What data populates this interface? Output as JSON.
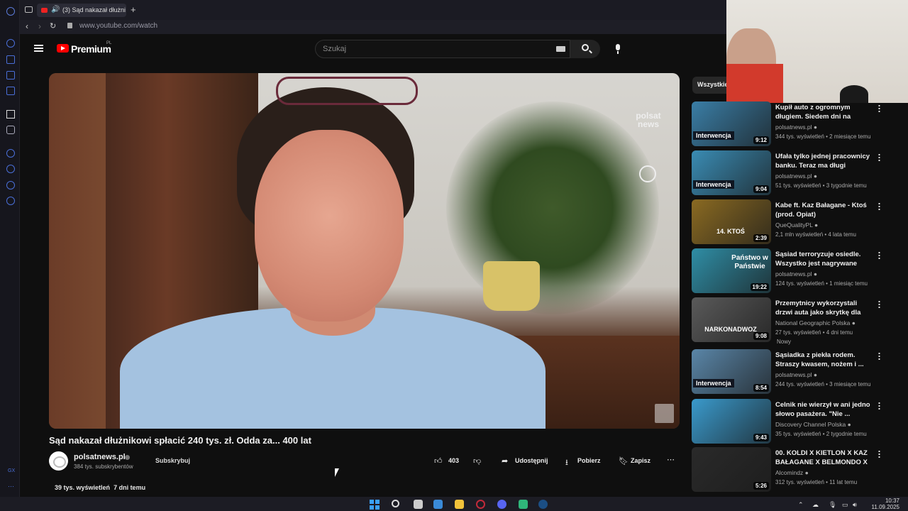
{
  "browser": {
    "tab_title": "(3) Sąd nakazał dłużni",
    "url": "www.youtube.com/watch"
  },
  "youtube": {
    "logo": "Premium",
    "logo_region": "PL",
    "search_placeholder": "Szukaj",
    "filter_chip": "Wszystkie"
  },
  "video": {
    "watermark_line1": "polsat",
    "watermark_line2": "news",
    "title": "Sąd nakazał dłużnikowi spłacić 240 tys. zł. Odda za... 400 lat",
    "channel": "polsatnews.pl",
    "subscribers": "384 tys. subskrybentów",
    "subscribe_label": "Subskrybuj",
    "likes": "403",
    "share_label": "Udostępnij",
    "download_label": "Pobierz",
    "save_label": "Zapisz",
    "views": "39 tys. wyświetleń",
    "age": "7 dni temu"
  },
  "recommendations": [
    {
      "title": "Kupił auto z ogromnym długiem. Siedem dni na zapłatę",
      "channel": "polsatnews.pl",
      "stats": "344 tys. wyświetleń • 2 miesiące temu",
      "duration": "9:12",
      "badge": "Interwencja",
      "thumb_color": "#3a7ea6"
    },
    {
      "title": "Ufała tylko jednej pracownicy banku. Teraz ma długi",
      "channel": "polsatnews.pl",
      "stats": "51 tys. wyświetleń • 3 tygodnie temu",
      "duration": "9:04",
      "badge": "Interwencja",
      "thumb_color": "#3a8cb4"
    },
    {
      "title": "Kabe ft. Kaz Bałagane - Ktoś (prod. Opiat)",
      "channel": "QueQualityPL",
      "stats": "2,1 mln wyświetleń • 4 lata temu",
      "duration": "2:39",
      "thumb_text": "14. KTOŚ",
      "thumb_color": "#8a6a22"
    },
    {
      "title": "Sąsiad terroryzuje osiedle. Wszystko jest nagrywane",
      "channel": "polsatnews.pl",
      "stats": "124 tys. wyświetleń • 1 miesiąc temu",
      "duration": "19:22",
      "thumb_text": "Państwo w Państwie",
      "thumb_color": "#2f8ea6"
    },
    {
      "title": "Przemytnicy wykorzystali drzwi auta jako skrytkę dla dużej ...",
      "channel": "National Geographic Polska",
      "stats": "27 tys. wyświetleń • 4 dni temu",
      "new_badge": "Nowy",
      "duration": "9:08",
      "thumb_text": "NARKONADWOZ",
      "thumb_color": "#5a5a5a"
    },
    {
      "title": "Sąsiadka z piekła rodem. Straszy kwasem, nożem i ...",
      "channel": "polsatnews.pl",
      "stats": "244 tys. wyświetleń • 3 miesiące temu",
      "duration": "8:54",
      "badge": "Interwencja",
      "thumb_color": "#5a86a8"
    },
    {
      "title": "Celnik nie wierzył w ani jedno słowo pasażera. \"Nie ...",
      "channel": "Discovery Channel Polska",
      "stats": "35 tys. wyświetleń • 2 tygodnie temu",
      "duration": "9:43",
      "thumb_color": "#3a9acc"
    },
    {
      "title": "00. KOLDI X KIETLON X KAZ BAŁAGANE X BELMONDO X ...",
      "channel": "Alcomindz",
      "stats": "312 tys. wyświetleń • 11 lat temu",
      "duration": "5:26",
      "thumb_color": "#2a2a2a"
    }
  ],
  "taskbar": {
    "time": "10:37",
    "date": "11.09.2025"
  }
}
